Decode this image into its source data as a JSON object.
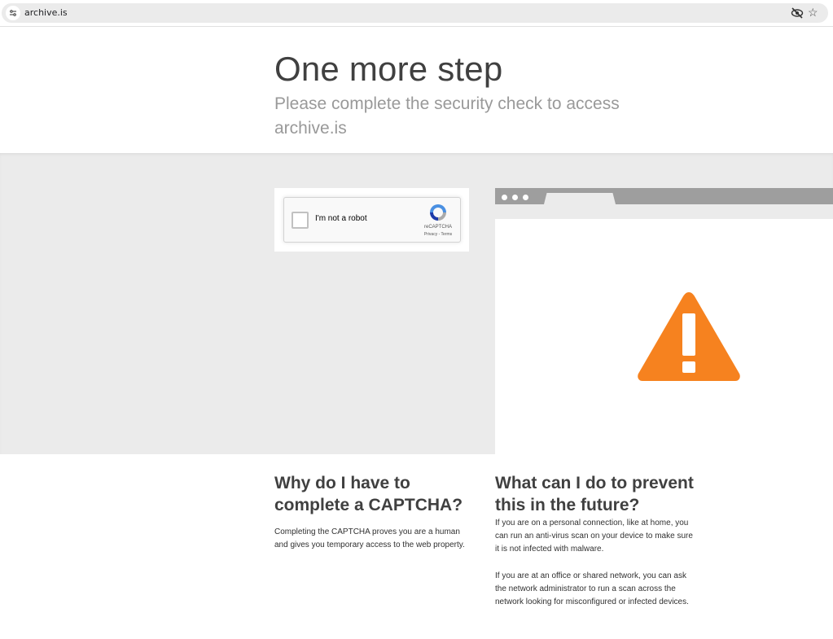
{
  "browser": {
    "url": "archive.is",
    "icons": [
      "site-settings-icon",
      "eye-off-icon",
      "star-icon"
    ]
  },
  "header": {
    "title": "One more step",
    "subtitle": "Please complete the security check to access archive.is"
  },
  "captcha": {
    "label": "I'm not a robot",
    "brand": "reCAPTCHA",
    "links": "Privacy - Terms"
  },
  "illustration": {
    "icon": "warning-icon",
    "accent": "#f6821f"
  },
  "why": {
    "title": "Why do I have to complete a CAPTCHA?",
    "text": "Completing the CAPTCHA proves you are a human and gives you temporary access to the web property."
  },
  "prevent": {
    "title": "What can I do to prevent this in the future?",
    "text1": "If you are on a personal connection, like at home, you can run an anti-virus scan on your device to make sure it is not infected with malware.",
    "text2": "If you are at an office or shared network, you can ask the network administrator to run a scan across the network looking for misconfigured or infected devices."
  }
}
